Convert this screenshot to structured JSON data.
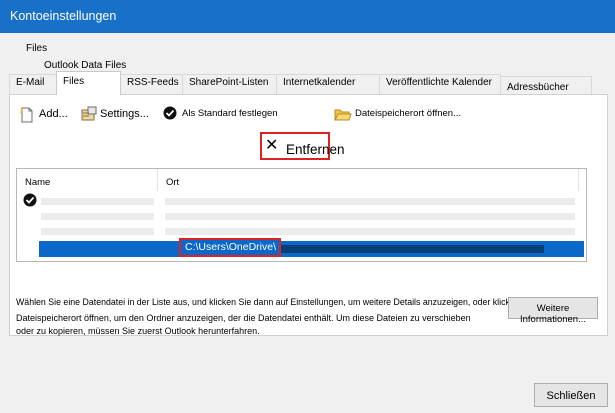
{
  "window": {
    "title": "Kontoeinstellungen"
  },
  "header": {
    "title": "Files",
    "subtitle": "Outlook Data Files"
  },
  "tabs": [
    {
      "label": "E-Mail"
    },
    {
      "label": "Files"
    },
    {
      "label": "RSS-Feeds"
    },
    {
      "label": "SharePoint-Listen"
    },
    {
      "label": "Internetkalender"
    },
    {
      "label": "Veröffentlichte Kalender"
    },
    {
      "label": "Adressbücher"
    }
  ],
  "toolbar": {
    "add": "Add...",
    "settings": "Settings...",
    "set_default": "Als Standard festlegen",
    "remove": "Entfernen",
    "open_location": "Dateispeicherort öffnen..."
  },
  "list": {
    "columns": [
      "Name",
      "Ort"
    ],
    "selected_path": "C:\\Users\\OneDrive\\"
  },
  "description": {
    "line1": "Wählen Sie eine Datendatei in der Liste aus, und klicken Sie dann auf Einstellungen, um weitere Details anzuzeigen, oder klicken Sie auf",
    "line2": "Dateispeicherort öffnen, um den Ordner anzuzeigen, der die Datendatei enthält. Um diese Dateien zu verschieben",
    "line3": "oder zu kopieren, müssen Sie zuerst Outlook herunterfahren."
  },
  "buttons": {
    "more_info": "Weitere Informationen...",
    "close": "Schließen"
  },
  "colors": {
    "titlebar": "#1870c9",
    "selection": "#0c68c8",
    "highlight": "#dc2323"
  }
}
